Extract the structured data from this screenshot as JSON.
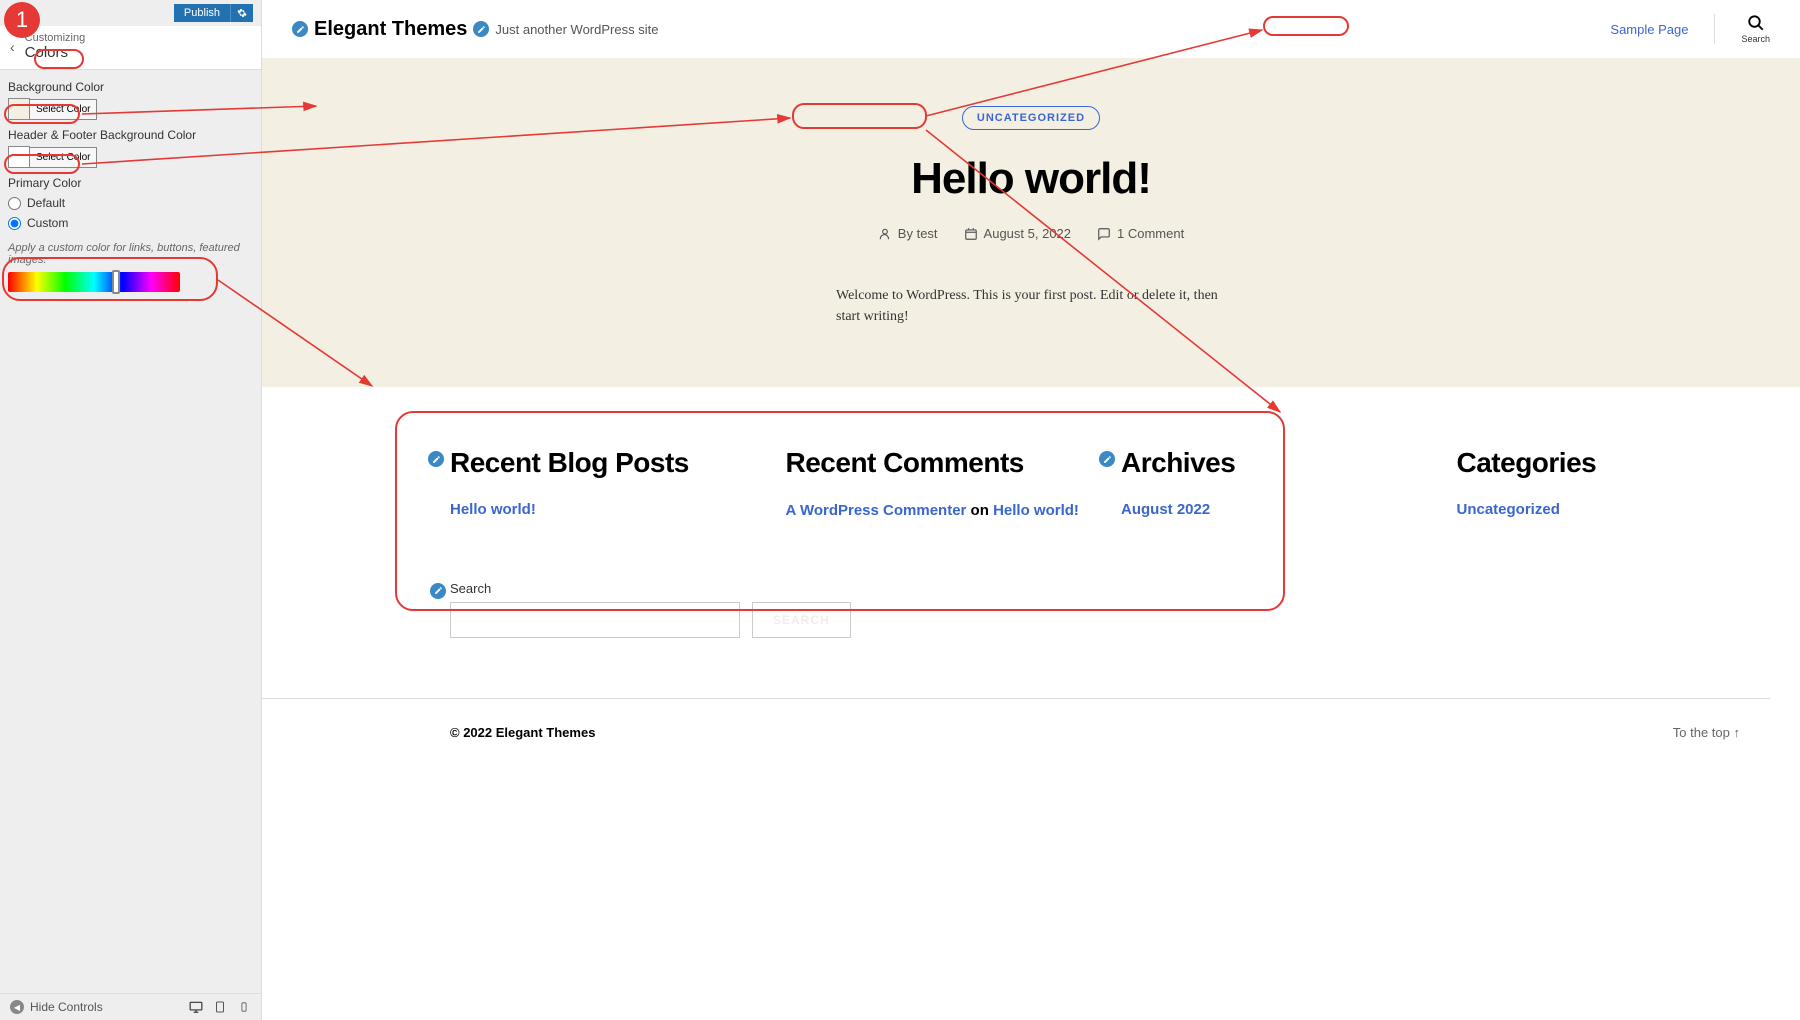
{
  "sidebar": {
    "publish_label": "Publish",
    "customizing_label": "Customizing",
    "section_title": "Colors",
    "bg_color_label": "Background Color",
    "hf_color_label": "Header & Footer Background Color",
    "select_color_label": "Select Color",
    "primary_color_label": "Primary Color",
    "default_label": "Default",
    "custom_label": "Custom",
    "custom_hint": "Apply a custom color for links, buttons, featured images.",
    "hide_controls_label": "Hide Controls",
    "bg_color": "#f4efe3",
    "hf_color": "#ffffff"
  },
  "preview": {
    "site_title": "Elegant Themes",
    "tagline": "Just another WordPress site",
    "sample_page": "Sample Page",
    "search_label": "Search",
    "category": "UNCATEGORIZED",
    "post_title": "Hello world!",
    "author_prefix": "By ",
    "author": "test",
    "date": "August 5, 2022",
    "comments": "1 Comment",
    "excerpt": "Welcome to WordPress. This is your first post. Edit or delete it, then start writing!",
    "widgets": {
      "recent_posts_title": "Recent Blog Posts",
      "recent_posts_link": "Hello world!",
      "recent_comments_title": "Recent Comments",
      "commenter": "A WordPress Commenter",
      "on": " on ",
      "comment_post": "Hello world!",
      "archives_title": "Archives",
      "archive_link": "August 2022",
      "categories_title": "Categories",
      "category_link": "Uncategorized"
    },
    "search_widget_title": "Search",
    "search_button": "SEARCH",
    "copyright": "© 2022 Elegant Themes",
    "to_top": "To the top ↑"
  },
  "annotation_number": "1"
}
